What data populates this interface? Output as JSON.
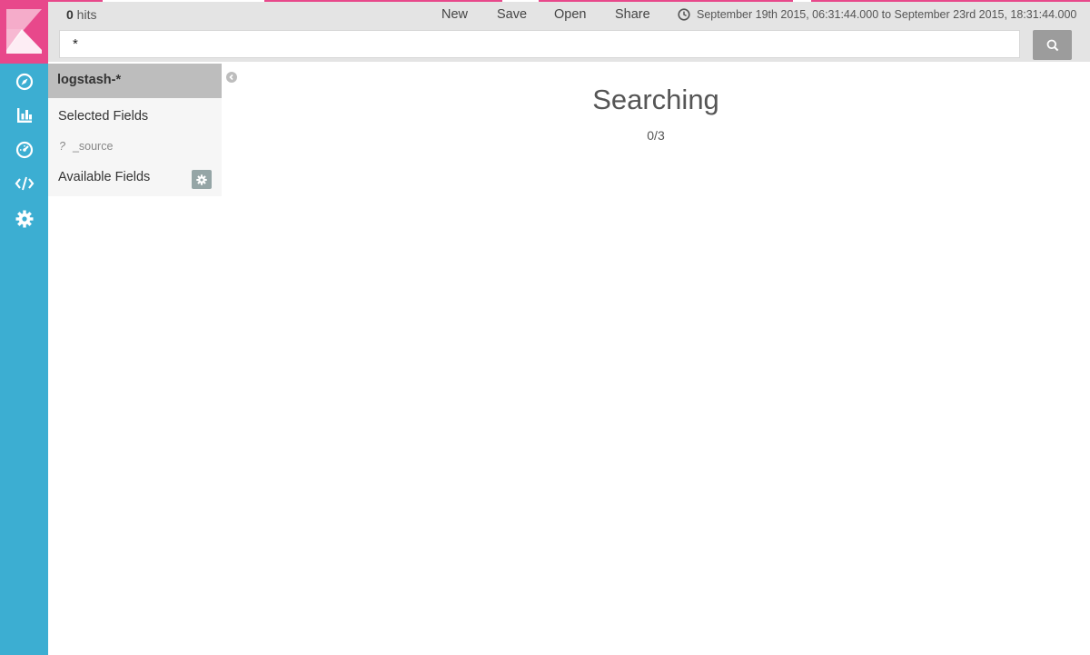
{
  "header": {
    "hits_count": "0",
    "hits_label": " hits",
    "menu": {
      "new_label": "New",
      "save_label": "Save",
      "open_label": "Open",
      "share_label": "Share"
    },
    "time_range": "September 19th 2015, 06:31:44.000 to September 23rd 2015, 18:31:44.000"
  },
  "search": {
    "query": "*"
  },
  "sidebar": {
    "index_pattern": "logstash-*",
    "selected_fields_title": "Selected Fields",
    "selected_fields": [
      {
        "type_icon": "?",
        "name": "_source"
      }
    ],
    "available_fields_title": "Available Fields"
  },
  "main": {
    "status_title": "Searching",
    "status_progress": "0/3"
  },
  "colors": {
    "nav_background": "#3caed2",
    "logo_background": "#e8488b",
    "loading_bar": "#e8488b"
  },
  "icons": {
    "nav": [
      "compass-icon",
      "bar-chart-icon",
      "dashboard-icon",
      "code-icon",
      "gear-icon"
    ],
    "search_button": "search-icon",
    "time_range": "clock-icon"
  }
}
